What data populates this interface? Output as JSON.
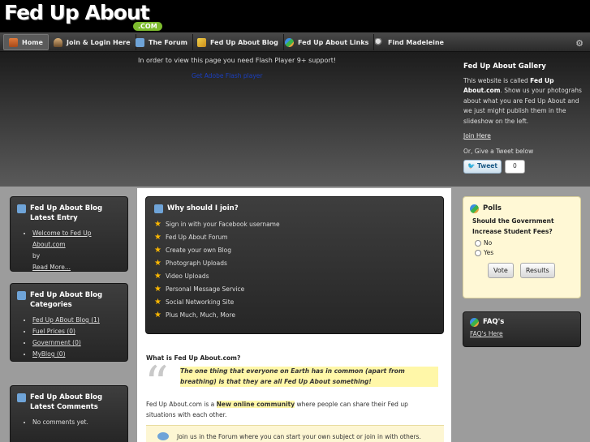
{
  "header": {
    "logo": "Fed Up About",
    "logo_suffix": ".COM"
  },
  "nav": {
    "items": [
      {
        "label": "Home",
        "icon": "home-icon"
      },
      {
        "label": "Join & Login Here",
        "icon": "user-icon"
      },
      {
        "label": "The Forum",
        "icon": "forum-icon"
      },
      {
        "label": "Fed Up About Blog",
        "icon": "pencil-icon"
      },
      {
        "label": "Fed Up About Links",
        "icon": "link-icon"
      },
      {
        "label": "Find Madeleine",
        "icon": "search-icon"
      }
    ],
    "settings_icon": "gear-icon"
  },
  "hero": {
    "flash_message": "In order to view this page you need Flash Player 9+ support!",
    "flash_link": "Get Adobe Flash player",
    "gallery": {
      "title": "Fed Up About Gallery",
      "text_pre": "This website is called ",
      "text_strong": "Fed Up About.com",
      "text_post": ". Show us your photograhs about what you are Fed Up About and we just might publish them in the slideshow on the left.",
      "join_link": "Join Here",
      "tweet_prompt": "Or, Give a Tweet below",
      "tweet_label": "Tweet",
      "tweet_count": "0"
    }
  },
  "left": {
    "latest_entry": {
      "title": "Fed Up About Blog Latest Entry",
      "post_link": "Welcome to Fed Up About.com",
      "by": "by",
      "read_more": "Read More..."
    },
    "categories": {
      "title": "Fed Up About Blog Categories",
      "items": [
        "Fed Up ABout Blog (1)",
        "Fuel Prices (0)",
        "Government (0)",
        "MyBlog (0)"
      ]
    },
    "comments": {
      "title": "Fed Up About Blog Latest Comments",
      "empty": "No comments yet."
    }
  },
  "center": {
    "why_title": "Why should I join?",
    "why_items": [
      "Sign in with your Facebook username",
      "Fed Up About Forum",
      "Create your own Blog",
      "Photograph Uploads",
      "Video Uploads",
      "Personal Message Service",
      "Social Networking Site",
      "Plus Much, Much, More"
    ],
    "what_title": "What is Fed Up About.com?",
    "quote": "The one thing that everyone on Earth has in common (apart from breathing) is that they are all Fed Up About something!",
    "desc_pre": "Fed Up About.com is a ",
    "desc_highlight": "New online community",
    "desc_post": " where people can share their Fed up situations with each other.",
    "forum_text": "Join us in the Forum where you can start your own subject or join in with others."
  },
  "right": {
    "polls": {
      "title": "Polls",
      "question": "Should the Government Increase Student Fees?",
      "options": [
        "No",
        "Yes"
      ],
      "vote_label": "Vote",
      "results_label": "Results"
    },
    "faqs": {
      "title": "FAQ's",
      "link": "FAQ's Here"
    }
  },
  "colors": {
    "logo_badge": "#7dbb2e",
    "highlight": "#fff7a8",
    "star": "#ffb800",
    "flash_link": "#1b3fbf"
  }
}
